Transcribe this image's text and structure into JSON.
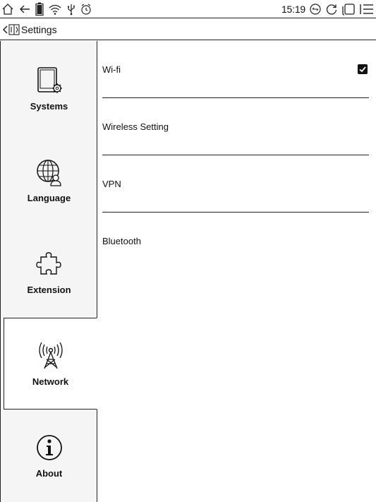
{
  "status_bar": {
    "time": "15:19",
    "left_icons": [
      "home-icon",
      "back-arrow-icon",
      "battery-icon",
      "wifi-icon",
      "usb-icon",
      "alarm-icon"
    ],
    "right_icons": [
      "sync-icon",
      "refresh-icon",
      "window-icon",
      "menu-icon"
    ]
  },
  "title_bar": {
    "title": "Settings",
    "back_icon": "back-chevron-icon",
    "app_icon": "settings-app-icon"
  },
  "sidebar": {
    "items": [
      {
        "label": "Systems",
        "icon": "tablet-gear-icon",
        "active": false
      },
      {
        "label": "Language",
        "icon": "globe-user-icon",
        "active": false
      },
      {
        "label": "Extension",
        "icon": "puzzle-icon",
        "active": false
      },
      {
        "label": "Network",
        "icon": "antenna-icon",
        "active": true
      },
      {
        "label": "About",
        "icon": "info-icon",
        "active": false
      }
    ]
  },
  "network": {
    "rows": [
      {
        "label": "Wi-fi",
        "checked": true
      },
      {
        "label": "Wireless Setting"
      },
      {
        "label": "VPN"
      },
      {
        "label": "Bluetooth"
      }
    ]
  }
}
